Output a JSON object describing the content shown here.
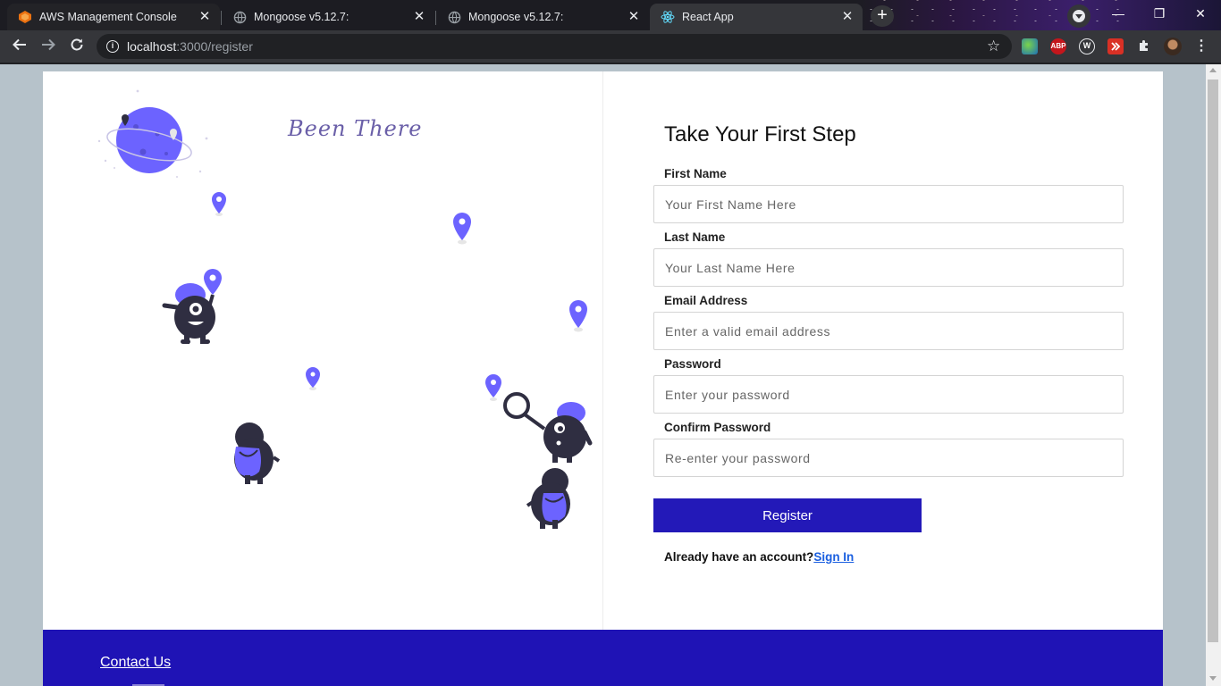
{
  "browser": {
    "tabs": [
      {
        "title": "AWS Management Console",
        "icon": "aws-icon",
        "active": false
      },
      {
        "title": "Mongoose v5.12.7:",
        "icon": "globe-icon",
        "active": false
      },
      {
        "title": "Mongoose v5.12.7:",
        "icon": "globe-icon",
        "active": false
      },
      {
        "title": "React App",
        "icon": "react-icon",
        "active": true
      }
    ],
    "url_host": "localhost",
    "url_path": ":3000/register",
    "extensions": [
      "ABP",
      "W"
    ]
  },
  "brand": {
    "name": "Been There"
  },
  "form": {
    "title": "Take Your First Step",
    "fields": [
      {
        "label": "First Name",
        "placeholder": "Your First Name Here",
        "type": "text"
      },
      {
        "label": "Last Name",
        "placeholder": "Your Last Name Here",
        "type": "text"
      },
      {
        "label": "Email Address",
        "placeholder": "Enter a valid email address",
        "type": "email"
      },
      {
        "label": "Password",
        "placeholder": "Enter your password",
        "type": "password"
      },
      {
        "label": "Confirm Password",
        "placeholder": "Re-enter your password",
        "type": "password"
      }
    ],
    "submit_label": "Register",
    "signin_prompt": "Already have an account?",
    "signin_link": "Sign In"
  },
  "footer": {
    "contact_link": "Contact Us"
  },
  "colors": {
    "primary": "#2319b8",
    "footer": "#1f13b5",
    "accent_purple": "#6c63ff",
    "dark_figure": "#2f2e41"
  }
}
